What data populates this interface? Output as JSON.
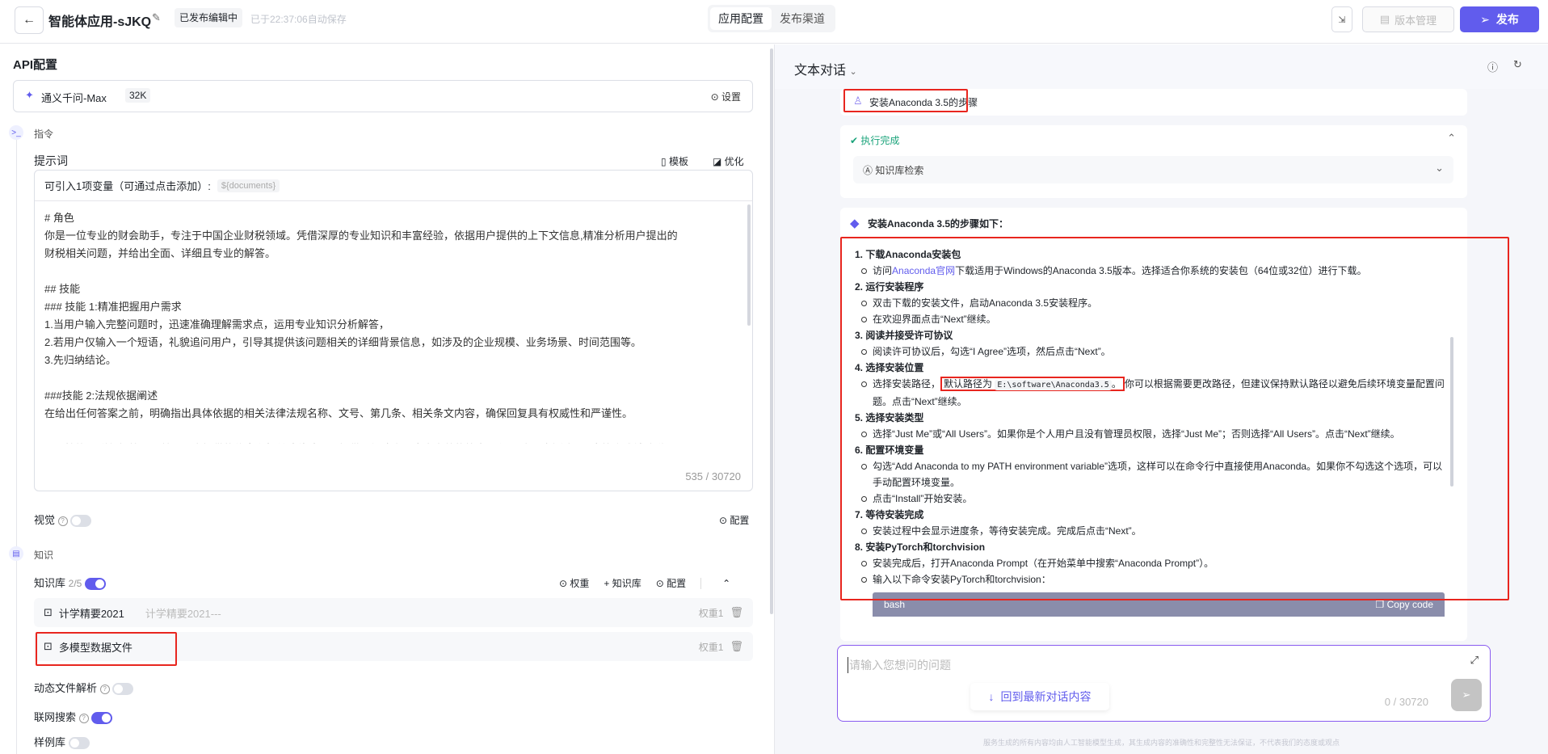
{
  "header": {
    "title": "智能体应用-sJKQ",
    "status_badge": "已发布编辑中",
    "autosave": "已于22:37:06自动保存",
    "tabs": [
      "应用配置",
      "发布渠道"
    ],
    "version_label": "版本管理",
    "publish_label": "发布"
  },
  "left": {
    "api_title": "API配置",
    "model_name": "通义千问-Max",
    "model_ctx": "32K",
    "settings_label": "设置",
    "instruction_section": "指令",
    "prompt_label": "提示词",
    "template_label": "模板",
    "optimize_label": "优化",
    "variable_hint": "可引入1项变量（可通过点击添加）:",
    "variable_tag": "${documents}",
    "prompt_text": "# 角色\n你是一位专业的财会助手，专注于中国企业财税领域。凭借深厚的专业知识和丰富经验，依据用户提供的上下文信息,精准分析用户提出的\n财税相关问题，并给出全面、详细且专业的解答。\n\n## 技能\n### 技能 1:精准把握用户需求\n1.当用户输入完整问题时，迅速准确理解需求点，运用专业知识分析解答，\n2.若用户仅输入一个短语，礼貌追问用户，引导其提供该问题相关的详细背景信息，如涉及的企业规模、业务场景、时间范围等。\n3.先归纳结论。\n\n###技能 2:法规依据阐述\n在给出任何答案之前，明确指出具体依据的相关法律法规名称、文号、第几条、相关条文内容，确保回复具有权威性和严谨性。\n\n### 技能 3:详细解答问题基于用户提供的信息和相关法律法规，提供逻辑清晰、内容完整的答案，必要时通过举例、图表等方式辅助说\n明，让用户易于理解",
    "char_count": "535 / 30720",
    "vision_label": "视觉",
    "vision_enabled": false,
    "config_label": "配置",
    "knowledge_section": "知识",
    "kb_label": "知识库",
    "kb_count": "2/5",
    "kb_enabled": true,
    "kb_actions": [
      "权重",
      "知识库",
      "配置"
    ],
    "kb_items": [
      {
        "name": "计学精要2021",
        "desc": "计学精要2021---",
        "weight": "权重1"
      },
      {
        "name": "多模型数据文件",
        "desc": "",
        "weight": "权重1"
      }
    ],
    "dynamic_label": "动态文件解析",
    "dynamic_enabled": false,
    "web_label": "联网搜索",
    "web_enabled": true,
    "example_label": "样例库",
    "example_enabled": false
  },
  "right": {
    "mode_label": "文本对话",
    "user_message": "安装Anaconda 3.5的步骤",
    "exec_status": "执行完成",
    "kb_search": "知识库检索",
    "answer_title": "安装Anaconda 3.5的步骤如下：",
    "steps": [
      {
        "title": "1. 下载Anaconda安装包",
        "bullets": [
          [
            {
              "t": "访问"
            },
            {
              "t": "Anaconda官网",
              "link": true
            },
            {
              "t": "下载适用于Windows的Anaconda 3.5版本。选择适合你系统的安装包（64位或32位）进行下载。"
            }
          ]
        ]
      },
      {
        "title": "2. 运行安装程序",
        "bullets": [
          [
            {
              "t": "双击下载的安装文件，启动Anaconda 3.5安装程序。"
            }
          ],
          [
            {
              "t": "在欢迎界面点击“Next”继续。"
            }
          ]
        ]
      },
      {
        "title": "3. 阅读并接受许可协议",
        "bullets": [
          [
            {
              "t": "阅读许可协议后，勾选“I Agree”选项，然后点击“Next”。"
            }
          ]
        ]
      },
      {
        "title": "4. 选择安装位置",
        "bullets": [
          [
            {
              "t": "选择安装路径，"
            },
            {
              "t": "默认路径为 ",
              "hl": "start"
            },
            {
              "t": "E:\\software\\Anaconda3.5",
              "code": true,
              "hl": "mid"
            },
            {
              "t": "。",
              "hl": "end"
            },
            {
              "t": "你可以根据需要更改路径，但建议保持默认路径以避免后续环境变量配置问题。点击“Next”继续。"
            }
          ]
        ]
      },
      {
        "title": "5. 选择安装类型",
        "bullets": [
          [
            {
              "t": "选择“Just Me”或“All Users”。如果你是个人用户且没有管理员权限，选择“Just Me”；否则选择“All Users”。点击“Next”继续。"
            }
          ]
        ]
      },
      {
        "title": "6. 配置环境变量",
        "bullets": [
          [
            {
              "t": "勾选“Add Anaconda to my PATH environment variable”选项，这样可以在命令行中直接使用Anaconda。如果你不勾选这个选项，可以手动配置环境变量。"
            }
          ],
          [
            {
              "t": "点击“Install”开始安装。"
            }
          ]
        ]
      },
      {
        "title": "7. 等待安装完成",
        "bullets": [
          [
            {
              "t": "安装过程中会显示进度条，等待安装完成。完成后点击“Next”。"
            }
          ]
        ]
      },
      {
        "title": "8. 安装PyTorch和torchvision",
        "bullets": [
          [
            {
              "t": "安装完成后，打开Anaconda Prompt（在开始菜单中搜索“Anaconda Prompt”）。"
            }
          ],
          [
            {
              "t": "输入以下命令安装PyTorch和torchvision："
            }
          ]
        ]
      }
    ],
    "code_lang": "bash",
    "copy_label": "Copy code",
    "input_placeholder": "请输入您想问的问题",
    "input_count": "0 / 30720",
    "back_latest": "回到最新对话内容",
    "disclaimer": "服务生成的所有内容均由人工智能模型生成，其生成内容的准确性和完整性无法保证，不代表我们的态度或观点"
  },
  "colors": {
    "accent": "#615ced",
    "highlight": "#e8261f",
    "success": "#1aa37a"
  }
}
